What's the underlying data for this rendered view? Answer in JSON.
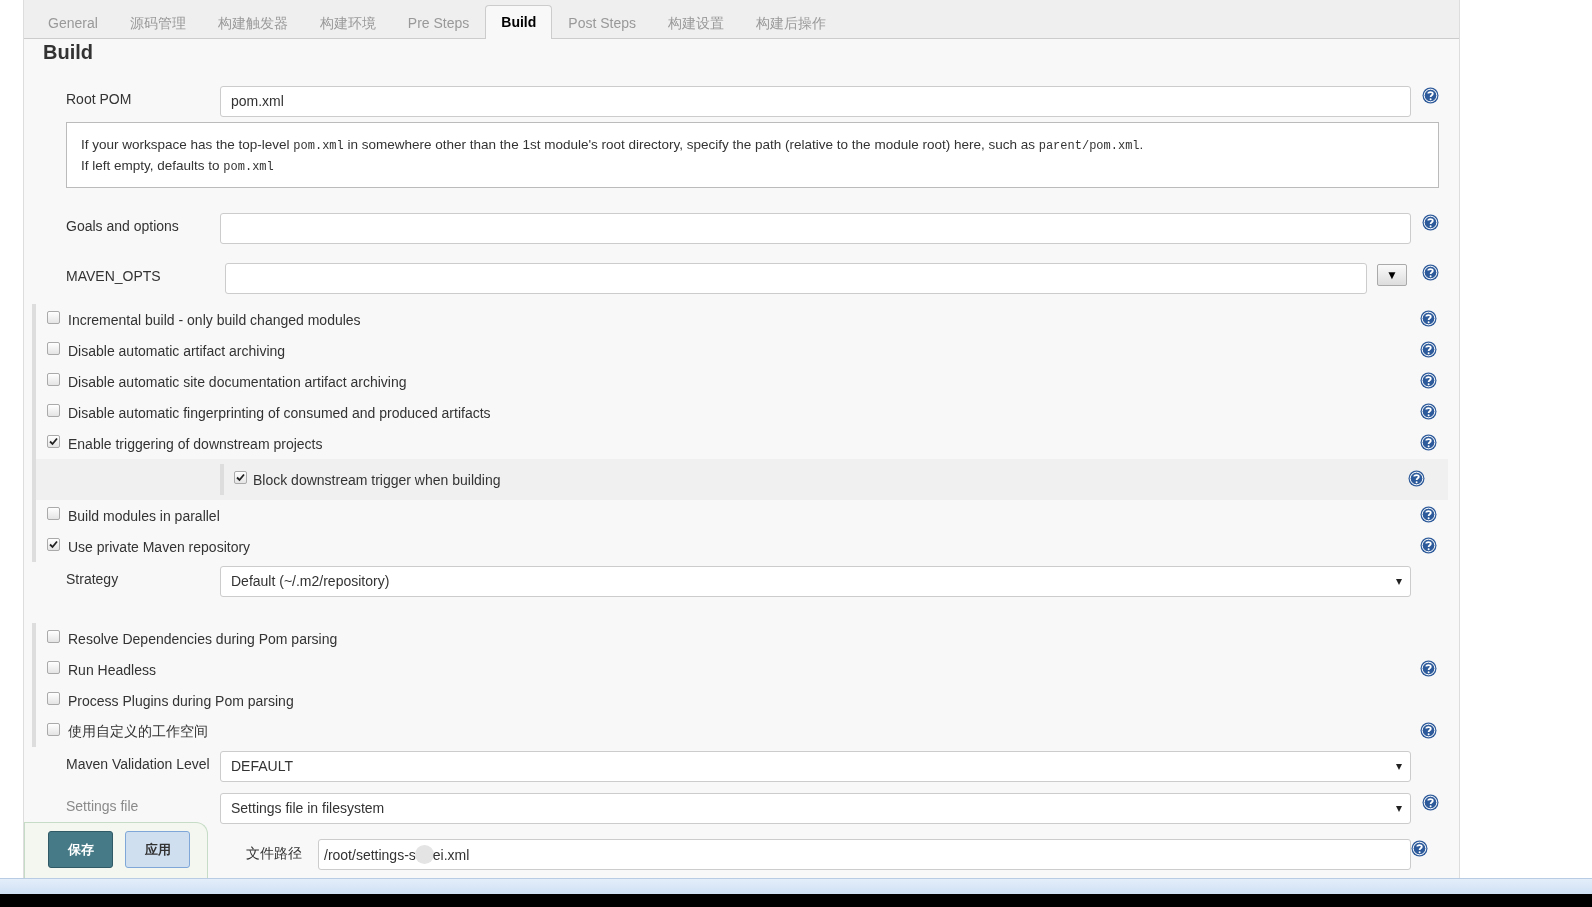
{
  "tabs": [
    {
      "label": "General",
      "selected": false
    },
    {
      "label": "源码管理",
      "selected": false
    },
    {
      "label": "构建触发器",
      "selected": false
    },
    {
      "label": "构建环境",
      "selected": false
    },
    {
      "label": "Pre Steps",
      "selected": false
    },
    {
      "label": "Build",
      "selected": true
    },
    {
      "label": "Post Steps",
      "selected": false
    },
    {
      "label": "构建设置",
      "selected": false
    },
    {
      "label": "构建后操作",
      "selected": false
    }
  ],
  "section_title": "Build",
  "root_pom": {
    "label": "Root POM",
    "value": "pom.xml",
    "help": true
  },
  "root_pom_help": [
    [
      {
        "kind": "text",
        "text": "If your workspace has the top-level "
      },
      {
        "kind": "code",
        "text": "pom.xml"
      },
      {
        "kind": "text",
        "text": " in somewhere other than the 1st module's root directory, specify the path (relative to the module root) here, such as "
      },
      {
        "kind": "code",
        "text": "parent/pom.xml"
      },
      {
        "kind": "text",
        "text": "."
      }
    ],
    [
      {
        "kind": "text",
        "text": "If left empty, defaults to "
      },
      {
        "kind": "code",
        "text": "pom.xml"
      }
    ]
  ],
  "goals": {
    "label": "Goals and options",
    "help": true
  },
  "maven_opts": {
    "label": "MAVEN_OPTS",
    "expand_button": "▼",
    "help": true
  },
  "options": [
    {
      "label": "Incremental build - only build changed modules",
      "checked": false,
      "help": true
    },
    {
      "label": "Disable automatic artifact archiving",
      "checked": false,
      "help": true
    },
    {
      "label": "Disable automatic site documentation artifact archiving",
      "checked": false,
      "help": true
    },
    {
      "label": "Disable automatic fingerprinting of consumed and produced artifacts",
      "checked": false,
      "help": true
    },
    {
      "label": "Enable triggering of downstream projects",
      "checked": true,
      "help": true,
      "children": [
        {
          "label": "Block downstream trigger when building",
          "checked": true,
          "help": true
        }
      ]
    },
    {
      "label": "Build modules in parallel",
      "checked": false,
      "help": true
    },
    {
      "label": "Use private Maven repository",
      "checked": true,
      "help": true
    }
  ],
  "strategy": {
    "label": "Strategy",
    "value": "Default (~/.m2/repository)"
  },
  "options_2": [
    {
      "label": "Resolve Dependencies during Pom parsing",
      "checked": false,
      "help": false
    },
    {
      "label": "Run Headless",
      "checked": false,
      "help": true
    },
    {
      "label": "Process Plugins during Pom parsing",
      "checked": false,
      "help": false
    },
    {
      "label": "使用自定义的工作空间",
      "checked": false,
      "help": true
    }
  ],
  "validation_level": {
    "label": "Maven Validation Level",
    "value": "DEFAULT"
  },
  "settings_file": {
    "label": "Settings file",
    "value": "Settings file in filesystem",
    "help": true
  },
  "file_path": {
    "label": "文件路径",
    "value_start": "/root/settings-s",
    "value_end": "ei.xml",
    "help": true
  },
  "buttons": [
    {
      "label": "保存",
      "kind": "primary"
    },
    {
      "label": "应用",
      "kind": "secondary"
    }
  ]
}
